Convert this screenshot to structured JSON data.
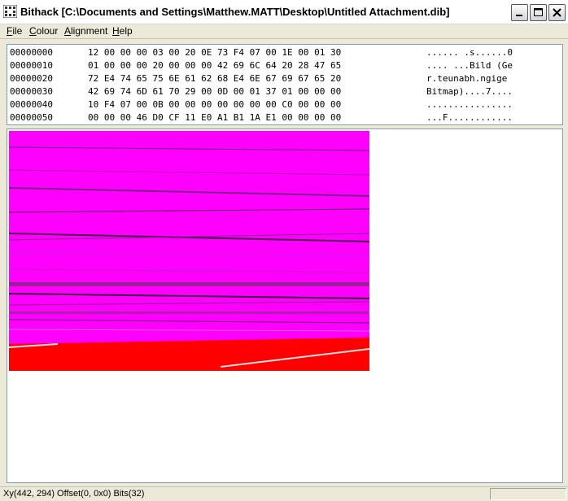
{
  "window": {
    "title": "Bithack [C:\\Documents and Settings\\Matthew.MATT\\Desktop\\Untitled Attachment.dib]"
  },
  "menu": [
    {
      "label": "File",
      "key": "F",
      "rest": "ile"
    },
    {
      "label": "Colour",
      "key": "C",
      "rest": "olour"
    },
    {
      "label": "Alignment",
      "key": "A",
      "rest": "lignment"
    },
    {
      "label": "Help",
      "key": "H",
      "rest": "elp"
    }
  ],
  "hex_rows": [
    {
      "offset": "00000000",
      "bytes": "12 00 00 00 03 00 20 0E 73 F4 07 00 1E 00 01 30",
      "ascii": "...... .s......0"
    },
    {
      "offset": "00000010",
      "bytes": "01 00 00 00 20 00 00 00 42 69 6C 64 20 28 47 65",
      "ascii": ".... ...Bild (Ge"
    },
    {
      "offset": "00000020",
      "bytes": "72 E4 74 65 75 6E 61 62 68 E4 6E 67 69 67 65 20",
      "ascii": "r.teunabh.ngige "
    },
    {
      "offset": "00000030",
      "bytes": "42 69 74 6D 61 70 29 00 0D 00 01 37 01 00 00 00",
      "ascii": "Bitmap)....7...."
    },
    {
      "offset": "00000040",
      "bytes": "10 F4 07 00 0B 00 00 00 00 00 00 00 C0 00 00 00",
      "ascii": "................"
    },
    {
      "offset": "00000050",
      "bytes": "00 00 00 46 D0 CF 11 E0 A1 B1 1A E1 00 00 00 00",
      "ascii": "...F............"
    }
  ],
  "status": {
    "text": "Xy(442, 294) Offset(0, 0x0) Bits(32)"
  },
  "colors": {
    "bitmap_magenta": "#ff00ff",
    "bitmap_red": "#ff0000",
    "close_button": "#d9442c"
  },
  "icons": [
    "bithack-app-icon",
    "minimize-icon",
    "maximize-icon",
    "close-icon"
  ]
}
